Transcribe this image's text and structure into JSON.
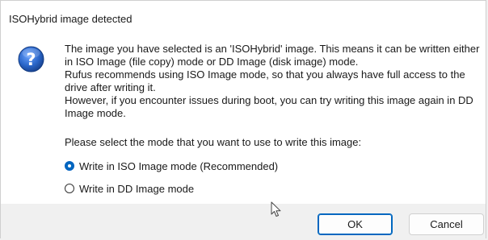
{
  "dialog": {
    "title": "ISOHybrid image detected",
    "icon": "question-icon",
    "message_lines": [
      "The image you have selected is an 'ISOHybrid' image. This means it can be written either",
      "in ISO Image (file copy) mode or DD Image (disk image) mode.",
      "Rufus recommends using ISO Image mode, so that you always have full access to the",
      "drive after writing it.",
      "However, if you encounter issues during boot, you can try writing this image again in DD",
      "Image mode."
    ],
    "prompt": "Please select the mode that you want to use to write this image:",
    "options": [
      {
        "label": "Write in ISO Image mode (Recommended)",
        "selected": true
      },
      {
        "label": "Write in DD Image mode",
        "selected": false
      }
    ],
    "buttons": {
      "ok": "OK",
      "cancel": "Cancel"
    },
    "colors": {
      "accent": "#0067c0",
      "icon_blue": "#1f5fbf"
    }
  }
}
